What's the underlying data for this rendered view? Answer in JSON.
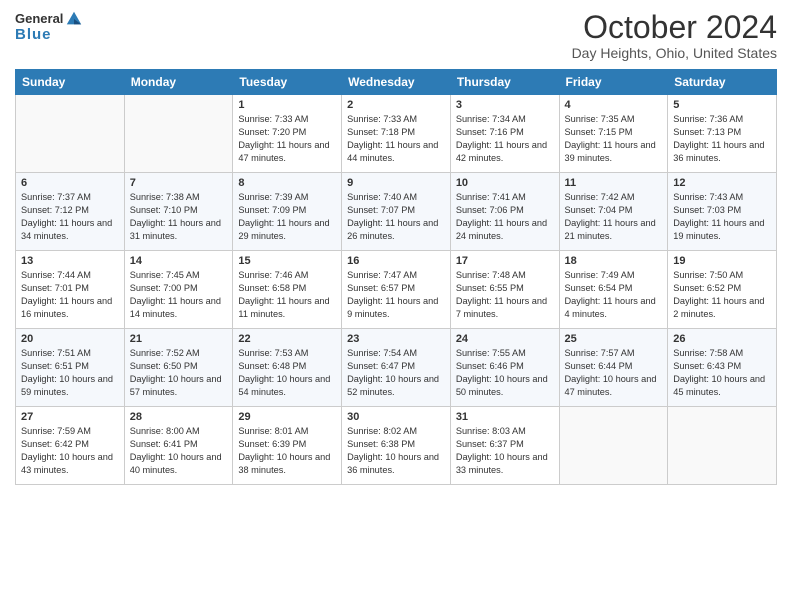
{
  "header": {
    "logo_line1": "General",
    "logo_line2": "Blue",
    "main_title": "October 2024",
    "subtitle": "Day Heights, Ohio, United States"
  },
  "days_of_week": [
    "Sunday",
    "Monday",
    "Tuesday",
    "Wednesday",
    "Thursday",
    "Friday",
    "Saturday"
  ],
  "weeks": [
    [
      {
        "day": "",
        "sunrise": "",
        "sunset": "",
        "daylight": ""
      },
      {
        "day": "",
        "sunrise": "",
        "sunset": "",
        "daylight": ""
      },
      {
        "day": "1",
        "sunrise": "Sunrise: 7:33 AM",
        "sunset": "Sunset: 7:20 PM",
        "daylight": "Daylight: 11 hours and 47 minutes."
      },
      {
        "day": "2",
        "sunrise": "Sunrise: 7:33 AM",
        "sunset": "Sunset: 7:18 PM",
        "daylight": "Daylight: 11 hours and 44 minutes."
      },
      {
        "day": "3",
        "sunrise": "Sunrise: 7:34 AM",
        "sunset": "Sunset: 7:16 PM",
        "daylight": "Daylight: 11 hours and 42 minutes."
      },
      {
        "day": "4",
        "sunrise": "Sunrise: 7:35 AM",
        "sunset": "Sunset: 7:15 PM",
        "daylight": "Daylight: 11 hours and 39 minutes."
      },
      {
        "day": "5",
        "sunrise": "Sunrise: 7:36 AM",
        "sunset": "Sunset: 7:13 PM",
        "daylight": "Daylight: 11 hours and 36 minutes."
      }
    ],
    [
      {
        "day": "6",
        "sunrise": "Sunrise: 7:37 AM",
        "sunset": "Sunset: 7:12 PM",
        "daylight": "Daylight: 11 hours and 34 minutes."
      },
      {
        "day": "7",
        "sunrise": "Sunrise: 7:38 AM",
        "sunset": "Sunset: 7:10 PM",
        "daylight": "Daylight: 11 hours and 31 minutes."
      },
      {
        "day": "8",
        "sunrise": "Sunrise: 7:39 AM",
        "sunset": "Sunset: 7:09 PM",
        "daylight": "Daylight: 11 hours and 29 minutes."
      },
      {
        "day": "9",
        "sunrise": "Sunrise: 7:40 AM",
        "sunset": "Sunset: 7:07 PM",
        "daylight": "Daylight: 11 hours and 26 minutes."
      },
      {
        "day": "10",
        "sunrise": "Sunrise: 7:41 AM",
        "sunset": "Sunset: 7:06 PM",
        "daylight": "Daylight: 11 hours and 24 minutes."
      },
      {
        "day": "11",
        "sunrise": "Sunrise: 7:42 AM",
        "sunset": "Sunset: 7:04 PM",
        "daylight": "Daylight: 11 hours and 21 minutes."
      },
      {
        "day": "12",
        "sunrise": "Sunrise: 7:43 AM",
        "sunset": "Sunset: 7:03 PM",
        "daylight": "Daylight: 11 hours and 19 minutes."
      }
    ],
    [
      {
        "day": "13",
        "sunrise": "Sunrise: 7:44 AM",
        "sunset": "Sunset: 7:01 PM",
        "daylight": "Daylight: 11 hours and 16 minutes."
      },
      {
        "day": "14",
        "sunrise": "Sunrise: 7:45 AM",
        "sunset": "Sunset: 7:00 PM",
        "daylight": "Daylight: 11 hours and 14 minutes."
      },
      {
        "day": "15",
        "sunrise": "Sunrise: 7:46 AM",
        "sunset": "Sunset: 6:58 PM",
        "daylight": "Daylight: 11 hours and 11 minutes."
      },
      {
        "day": "16",
        "sunrise": "Sunrise: 7:47 AM",
        "sunset": "Sunset: 6:57 PM",
        "daylight": "Daylight: 11 hours and 9 minutes."
      },
      {
        "day": "17",
        "sunrise": "Sunrise: 7:48 AM",
        "sunset": "Sunset: 6:55 PM",
        "daylight": "Daylight: 11 hours and 7 minutes."
      },
      {
        "day": "18",
        "sunrise": "Sunrise: 7:49 AM",
        "sunset": "Sunset: 6:54 PM",
        "daylight": "Daylight: 11 hours and 4 minutes."
      },
      {
        "day": "19",
        "sunrise": "Sunrise: 7:50 AM",
        "sunset": "Sunset: 6:52 PM",
        "daylight": "Daylight: 11 hours and 2 minutes."
      }
    ],
    [
      {
        "day": "20",
        "sunrise": "Sunrise: 7:51 AM",
        "sunset": "Sunset: 6:51 PM",
        "daylight": "Daylight: 10 hours and 59 minutes."
      },
      {
        "day": "21",
        "sunrise": "Sunrise: 7:52 AM",
        "sunset": "Sunset: 6:50 PM",
        "daylight": "Daylight: 10 hours and 57 minutes."
      },
      {
        "day": "22",
        "sunrise": "Sunrise: 7:53 AM",
        "sunset": "Sunset: 6:48 PM",
        "daylight": "Daylight: 10 hours and 54 minutes."
      },
      {
        "day": "23",
        "sunrise": "Sunrise: 7:54 AM",
        "sunset": "Sunset: 6:47 PM",
        "daylight": "Daylight: 10 hours and 52 minutes."
      },
      {
        "day": "24",
        "sunrise": "Sunrise: 7:55 AM",
        "sunset": "Sunset: 6:46 PM",
        "daylight": "Daylight: 10 hours and 50 minutes."
      },
      {
        "day": "25",
        "sunrise": "Sunrise: 7:57 AM",
        "sunset": "Sunset: 6:44 PM",
        "daylight": "Daylight: 10 hours and 47 minutes."
      },
      {
        "day": "26",
        "sunrise": "Sunrise: 7:58 AM",
        "sunset": "Sunset: 6:43 PM",
        "daylight": "Daylight: 10 hours and 45 minutes."
      }
    ],
    [
      {
        "day": "27",
        "sunrise": "Sunrise: 7:59 AM",
        "sunset": "Sunset: 6:42 PM",
        "daylight": "Daylight: 10 hours and 43 minutes."
      },
      {
        "day": "28",
        "sunrise": "Sunrise: 8:00 AM",
        "sunset": "Sunset: 6:41 PM",
        "daylight": "Daylight: 10 hours and 40 minutes."
      },
      {
        "day": "29",
        "sunrise": "Sunrise: 8:01 AM",
        "sunset": "Sunset: 6:39 PM",
        "daylight": "Daylight: 10 hours and 38 minutes."
      },
      {
        "day": "30",
        "sunrise": "Sunrise: 8:02 AM",
        "sunset": "Sunset: 6:38 PM",
        "daylight": "Daylight: 10 hours and 36 minutes."
      },
      {
        "day": "31",
        "sunrise": "Sunrise: 8:03 AM",
        "sunset": "Sunset: 6:37 PM",
        "daylight": "Daylight: 10 hours and 33 minutes."
      },
      {
        "day": "",
        "sunrise": "",
        "sunset": "",
        "daylight": ""
      },
      {
        "day": "",
        "sunrise": "",
        "sunset": "",
        "daylight": ""
      }
    ]
  ]
}
